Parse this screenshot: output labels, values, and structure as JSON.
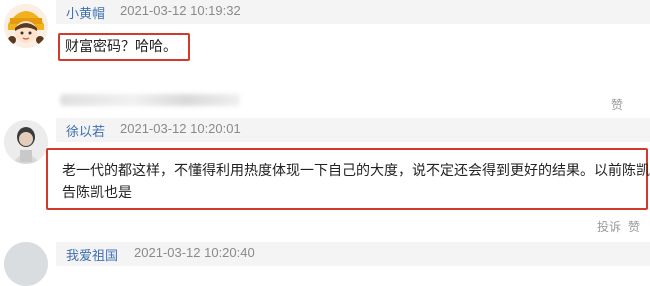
{
  "comments": [
    {
      "user": "小黄帽",
      "time": "2021-03-12 10:19:32",
      "text": "财富密码？哈哈。",
      "like_label": "赞"
    },
    {
      "user": "徐以若",
      "time": "2021-03-12 10:20:01",
      "text_line1": "老一代的都这样，不懂得利用热度体现一下自己的大度，说不定还会得到更好的结果。以前陈凯歌",
      "text_line2": "告陈凯也是",
      "report_label": "投诉",
      "like_label": "赞"
    },
    {
      "user": "我爱祖国",
      "time": "2021-03-12 10:20:40"
    }
  ],
  "colors": {
    "username": "#3f6fb0",
    "highlight_border": "#d23a2c",
    "meta_background": "#f4f4f4"
  }
}
